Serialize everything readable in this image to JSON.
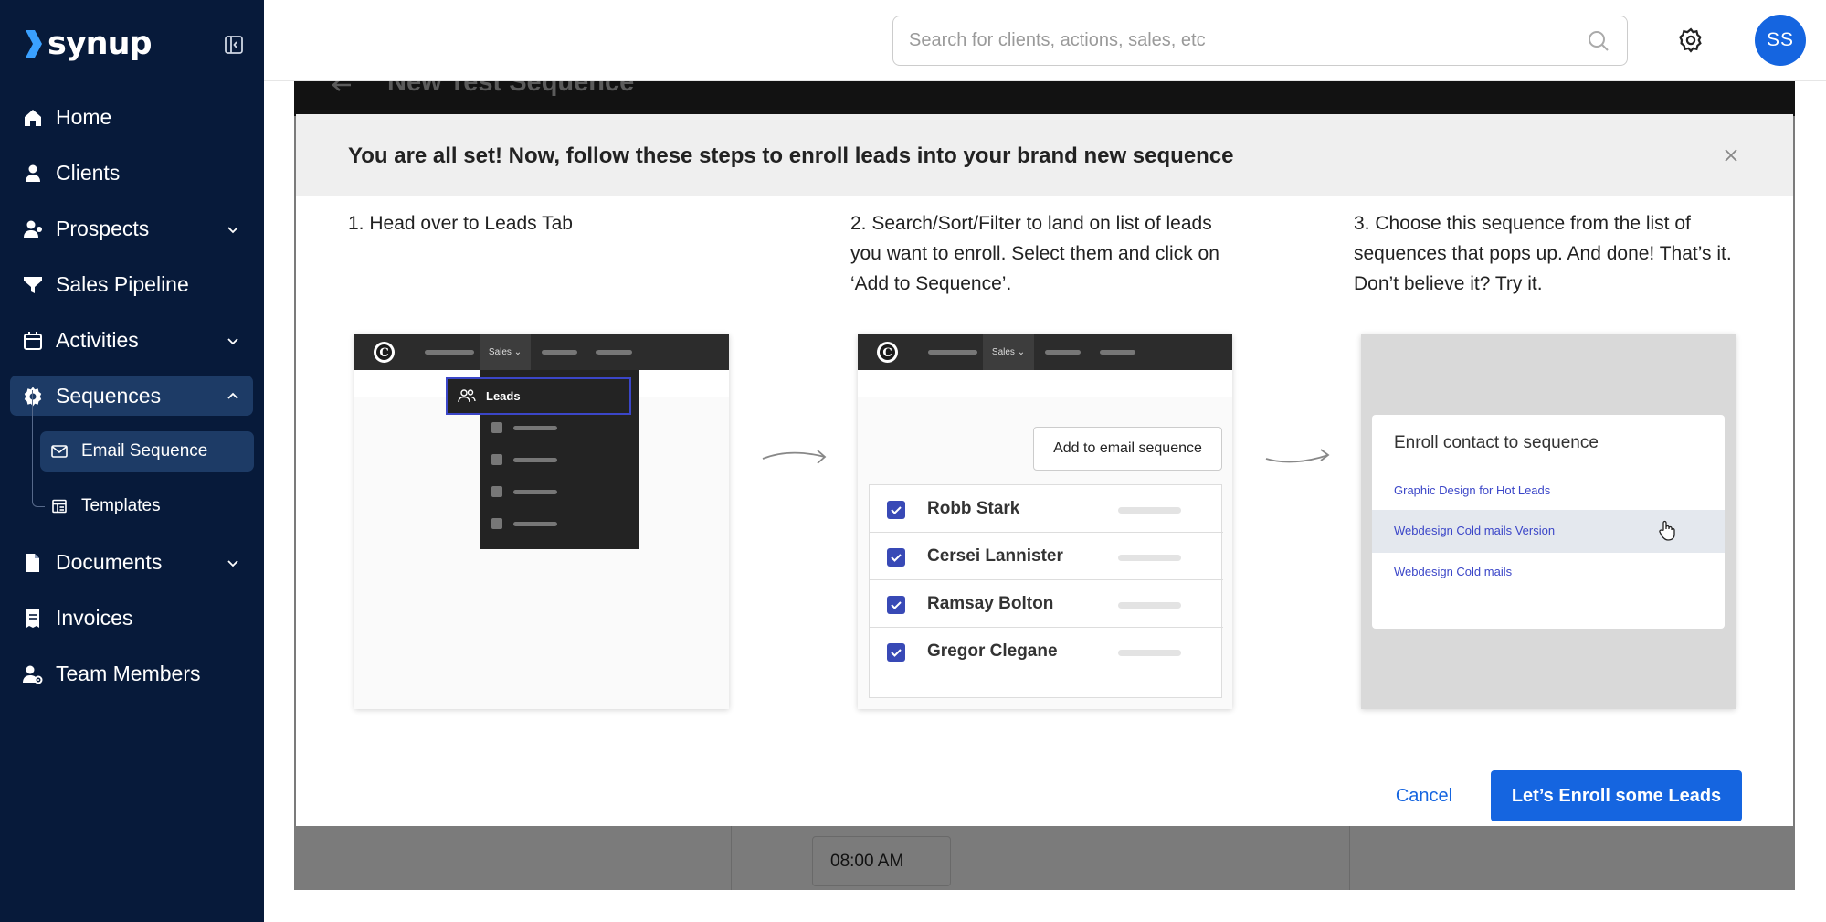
{
  "brand": {
    "name": "synup",
    "accent": "#1565e0",
    "sidebar_bg": "#071a3a"
  },
  "sidebar": {
    "items": [
      {
        "label": "Home",
        "icon": "home-icon"
      },
      {
        "label": "Clients",
        "icon": "person-icon"
      },
      {
        "label": "Prospects",
        "icon": "prospects-icon",
        "expandable": true
      },
      {
        "label": "Sales Pipeline",
        "icon": "funnel-icon"
      },
      {
        "label": "Activities",
        "icon": "calendar-icon",
        "expandable": true
      },
      {
        "label": "Sequences",
        "icon": "gear-icon",
        "expanded": true,
        "active": true
      },
      {
        "label": "Documents",
        "icon": "document-icon",
        "expandable": true
      },
      {
        "label": "Invoices",
        "icon": "invoice-icon"
      },
      {
        "label": "Team Members",
        "icon": "team-members-icon"
      }
    ],
    "sequences_sub": [
      {
        "label": "Email Sequence",
        "icon": "mail-icon",
        "active": true
      },
      {
        "label": "Templates",
        "icon": "template-icon"
      }
    ]
  },
  "topbar": {
    "search_placeholder": "Search for clients, actions, sales, etc",
    "avatar_initials": "SS"
  },
  "background": {
    "sequence_title": "New Test Sequence",
    "time_value": "08:00 AM"
  },
  "modal": {
    "title": "You are all set! Now, follow these steps to enroll leads into your brand new sequence",
    "steps": [
      {
        "text": "1. Head over to Leads Tab"
      },
      {
        "text": "2. Search/Sort/Filter to land on list of leads you want to enroll. Select them and click on ‘Add to Sequence’."
      },
      {
        "text": "3. Choose this sequence from the list of sequences that pops up. And done! That’s it. Don’t believe it? Try it."
      }
    ],
    "illustration1": {
      "tab_label": "Sales ⌄",
      "leads_label": "Leads",
      "logo_letter": "C"
    },
    "illustration2": {
      "tab_label": "Sales ⌄",
      "logo_letter": "C",
      "button_label": "Add to email sequence",
      "leads": [
        "Robb Stark",
        "Cersei Lannister",
        "Ramsay Bolton",
        "Gregor Clegane"
      ]
    },
    "illustration3": {
      "card_title": "Enroll contact to sequence",
      "options": [
        "Graphic Design for Hot Leads",
        "Webdesign Cold mails Version",
        "Webdesign Cold mails"
      ],
      "highlighted_index": 1
    },
    "cancel_label": "Cancel",
    "primary_label": "Let’s Enroll some Leads"
  }
}
